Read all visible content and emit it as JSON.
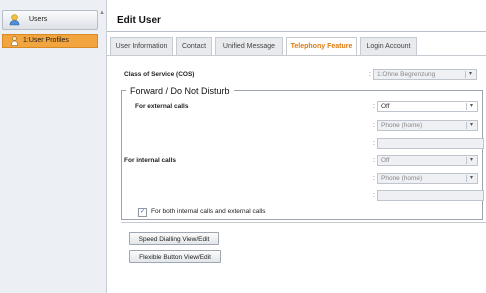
{
  "sidebar": {
    "header_label": "Users",
    "items": [
      {
        "label": "1:User Profiles"
      }
    ]
  },
  "main": {
    "title": "Edit User",
    "tabs": [
      {
        "label": "User Information",
        "active": false
      },
      {
        "label": "Contact",
        "active": false
      },
      {
        "label": "Unified Message",
        "active": false
      },
      {
        "label": "Telephony Feature",
        "active": true
      },
      {
        "label": "Login Account",
        "active": false
      }
    ]
  },
  "form": {
    "cos_label": "Class of Service (COS)",
    "cos_value": "1:Ohne Begrenzung",
    "fwd_legend": "Forward / Do Not Disturb",
    "external_label": "For external calls",
    "external_mode": "Off",
    "external_destination": "Phone (home)",
    "external_number": "",
    "internal_label": "For internal calls",
    "internal_mode": "Off",
    "internal_destination": "Phone (home)",
    "internal_number": "",
    "both_label": "For both internal calls and external calls",
    "both_checked": true,
    "colon": ":"
  },
  "buttons": {
    "speed_dialling": "Speed Dialling View/Edit",
    "flexible_button": "Flexible Button View/Edit"
  },
  "colors": {
    "accent": "#e07a10",
    "selected_item": "#f2a53f"
  }
}
